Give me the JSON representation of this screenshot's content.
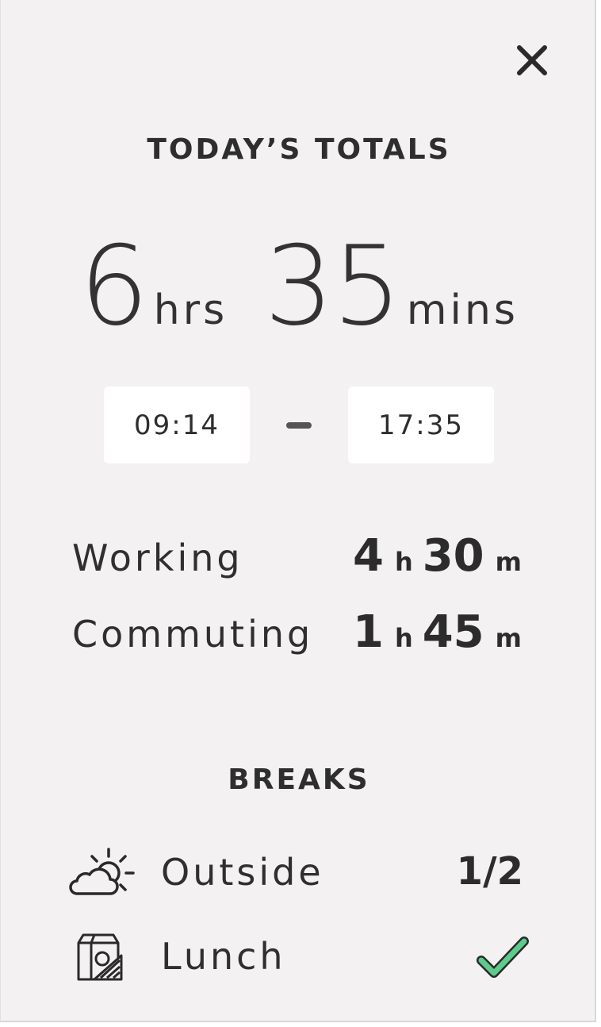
{
  "header": {
    "title": "TODAY’S TOTALS",
    "close_icon": "close-icon"
  },
  "total": {
    "hours": "6",
    "hours_unit": "hrs",
    "minutes": "35",
    "minutes_unit": "mins"
  },
  "time_range": {
    "start": "09:14",
    "end": "17:35"
  },
  "stats": [
    {
      "label": "Working",
      "hours": "4",
      "hours_unit": "h",
      "minutes": "30",
      "minutes_unit": "m"
    },
    {
      "label": "Commuting",
      "hours": "1",
      "hours_unit": "h",
      "minutes": "45",
      "minutes_unit": "m"
    }
  ],
  "breaks": {
    "title": "BREAKS",
    "items": [
      {
        "label": "Outside",
        "icon": "cloud-sun-icon",
        "status": "1/2"
      },
      {
        "label": "Lunch",
        "icon": "lunch-bag-icon",
        "status_icon": "checkmark-icon",
        "status_color": "#5ccb8c"
      }
    ]
  }
}
